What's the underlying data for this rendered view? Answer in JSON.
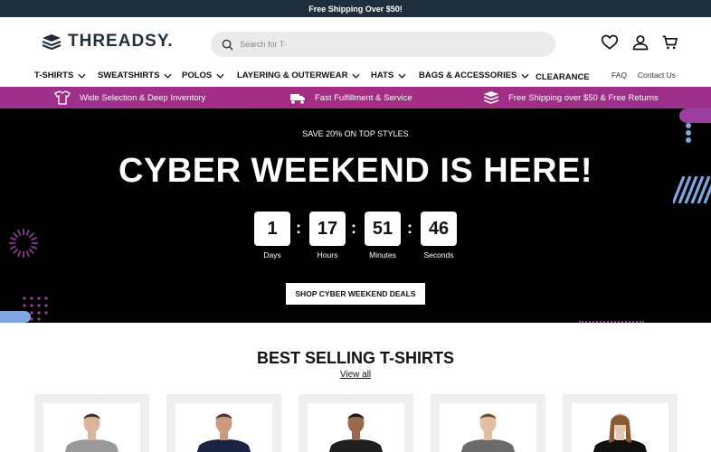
{
  "promo": {
    "text": "Free Shipping Over $50!"
  },
  "header": {
    "logo_text": "THREADSY.",
    "search_placeholder": "Search for T-",
    "icons": [
      "heart-icon",
      "user-icon",
      "cart-icon"
    ]
  },
  "nav": {
    "items": [
      {
        "label": "T-SHIRTS",
        "dropdown": true
      },
      {
        "label": "SWEATSHIRTS",
        "dropdown": true
      },
      {
        "label": "POLOS",
        "dropdown": true
      },
      {
        "label": "LAYERING & OUTERWEAR",
        "dropdown": true
      },
      {
        "label": "HATS",
        "dropdown": true
      },
      {
        "label": "BAGS & ACCESSORIES",
        "dropdown": true
      },
      {
        "label": "CLEARANCE",
        "dropdown": false
      }
    ],
    "utility": [
      "FAQ",
      "Contact Us"
    ]
  },
  "benefits": [
    {
      "icon": "tshirt-stack-icon",
      "text": "Wide Selection & Deep Inventory"
    },
    {
      "icon": "fast-truck-icon",
      "text": "Fast Fulfillment & Service"
    },
    {
      "icon": "box-stack-icon",
      "text": "Free Shipping over $50 & Free Returns"
    }
  ],
  "hero": {
    "subtitle": "SAVE 20% ON TOP STYLES",
    "title": "CYBER WEEKEND IS HERE!",
    "countdown": [
      {
        "value": "1",
        "label": "Days"
      },
      {
        "value": "17",
        "label": "Hours"
      },
      {
        "value": "51",
        "label": "Minutes"
      },
      {
        "value": "46",
        "label": "Seconds"
      }
    ],
    "cta": "SHOP CYBER WEEKEND DEALS"
  },
  "best_sellers": {
    "title": "BEST SELLING T-SHIRTS",
    "view_all": "View all",
    "products": [
      {
        "shirt_color": "#9a9a9a"
      },
      {
        "shirt_color": "#1c2444"
      },
      {
        "shirt_color": "#1e1e1e"
      },
      {
        "shirt_color": "#6b6b6b"
      },
      {
        "shirt_color": "#111111"
      }
    ]
  },
  "colors": {
    "promo_bg": "#1f2e3d",
    "benefits_bg": "#a12a84",
    "hero_bg": "#000000",
    "accent_purple": "#9b3f9e",
    "accent_blue": "#7fa6e0"
  }
}
